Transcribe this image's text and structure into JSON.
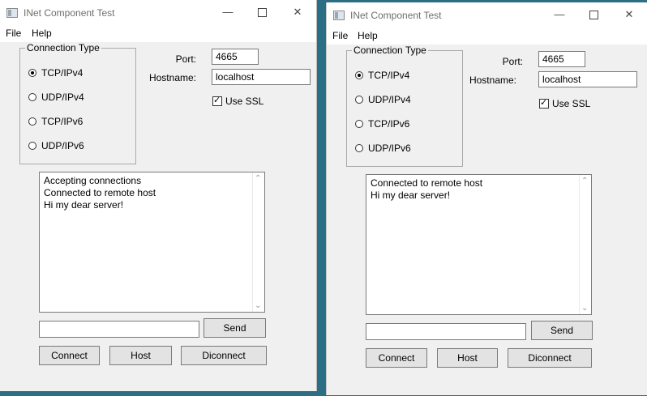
{
  "windows": [
    {
      "title": "INet Component Test",
      "menu": [
        "File",
        "Help"
      ],
      "connection_type": {
        "label": "Connection Type",
        "options": [
          {
            "label": "TCP/IPv4",
            "selected": true
          },
          {
            "label": "UDP/IPv4",
            "selected": false
          },
          {
            "label": "TCP/IPv6",
            "selected": false
          },
          {
            "label": "UDP/IPv6",
            "selected": false
          }
        ]
      },
      "port": {
        "label": "Port:",
        "value": "4665"
      },
      "hostname": {
        "label": "Hostname:",
        "value": "localhost"
      },
      "use_ssl": {
        "label": "Use SSL",
        "checked": true
      },
      "log": [
        "Accepting connections",
        "Connected to remote host",
        "Hi my dear server!"
      ],
      "message_input": {
        "value": ""
      },
      "buttons": {
        "send": "Send",
        "connect": "Connect",
        "host": "Host",
        "disconnect": "Diconnect"
      }
    },
    {
      "title": "INet Component Test",
      "menu": [
        "File",
        "Help"
      ],
      "connection_type": {
        "label": "Connection Type",
        "options": [
          {
            "label": "TCP/IPv4",
            "selected": true
          },
          {
            "label": "UDP/IPv4",
            "selected": false
          },
          {
            "label": "TCP/IPv6",
            "selected": false
          },
          {
            "label": "UDP/IPv6",
            "selected": false
          }
        ]
      },
      "port": {
        "label": "Port:",
        "value": "4665"
      },
      "hostname": {
        "label": "Hostname:",
        "value": "localhost"
      },
      "use_ssl": {
        "label": "Use SSL",
        "checked": true
      },
      "log": [
        "Connected to remote host",
        "Hi my dear server!"
      ],
      "message_input": {
        "value": ""
      },
      "buttons": {
        "send": "Send",
        "connect": "Connect",
        "host": "Host",
        "disconnect": "Diconnect"
      }
    }
  ]
}
